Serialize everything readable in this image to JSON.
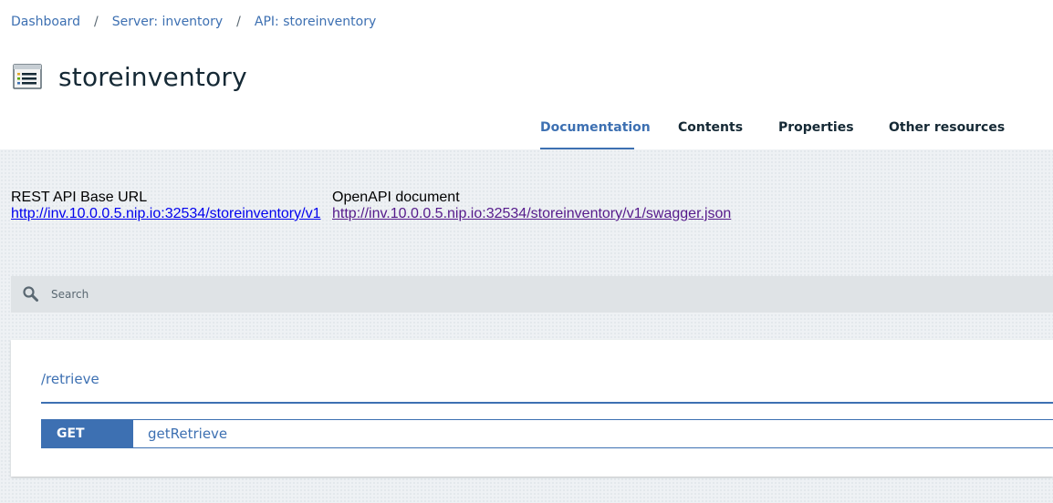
{
  "breadcrumb": {
    "items": [
      "Dashboard",
      "Server: inventory",
      "API: storeinventory"
    ],
    "separator": "/"
  },
  "page": {
    "title": "storeinventory",
    "icon": "api-list-icon"
  },
  "tabs": [
    {
      "label": "Documentation",
      "active": true
    },
    {
      "label": "Contents",
      "active": false
    },
    {
      "label": "Properties",
      "active": false
    },
    {
      "label": "Other resources",
      "active": false
    }
  ],
  "api_info": {
    "base_url_label": "REST API Base URL",
    "base_url": "http://inv.10.0.0.5.nip.io:32534/storeinventory/v1",
    "openapi_label": "OpenAPI document",
    "openapi_url": "http://inv.10.0.0.5.nip.io:32534/storeinventory/v1/swagger.json"
  },
  "search": {
    "placeholder": "Search",
    "icon": "search-icon"
  },
  "endpoints": [
    {
      "path": "/retrieve",
      "operations": [
        {
          "method": "GET",
          "operation_id": "getRetrieve"
        }
      ]
    }
  ],
  "colors": {
    "accent": "#3d70b2",
    "text": "#152935",
    "background": "#eef1f4",
    "link": "#0000ee",
    "visited_link": "#551a8b"
  }
}
